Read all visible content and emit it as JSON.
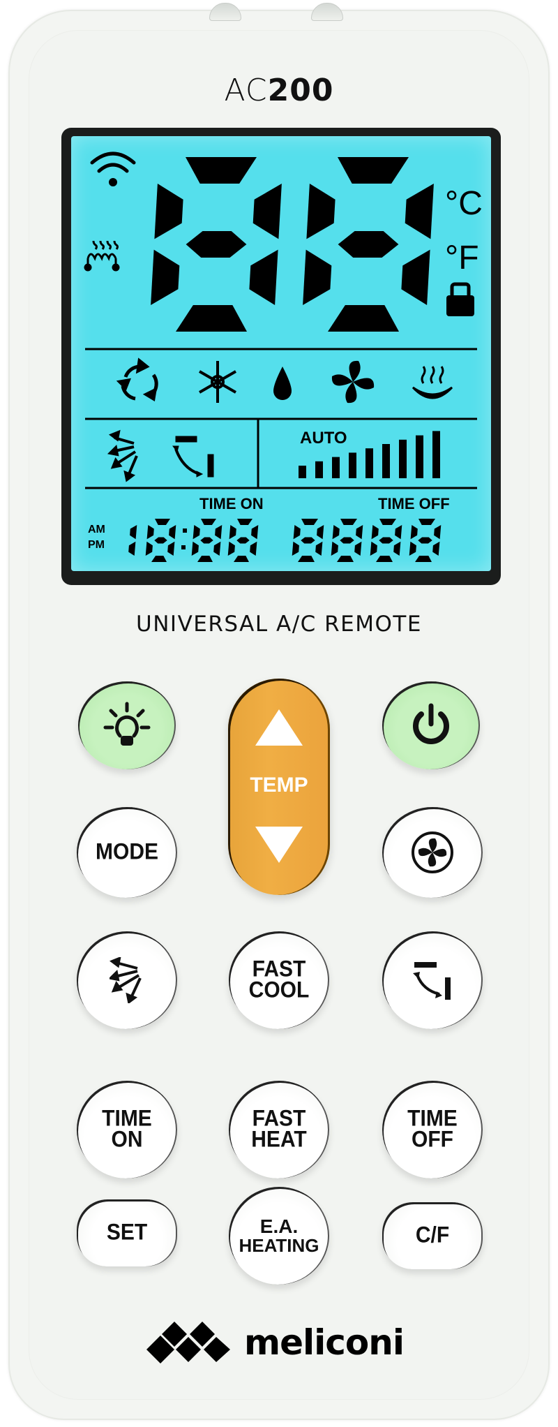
{
  "device": {
    "model_prefix": "AC",
    "model_number": "200",
    "subtitle": "UNIVERSAL A/C REMOTE",
    "brand": "meliconi",
    "colors": {
      "body": "#f3f5f2",
      "lcd_backlight": "#55dfec",
      "lcd_frame": "#1b1d1c",
      "green_button": "#c7f2bf",
      "temp_button": "#f0ae44"
    }
  },
  "lcd": {
    "main_temperature": "88",
    "unit_celsius": "°C",
    "unit_fahrenheit": "°F",
    "indicators_left": [
      "signal-icon",
      "heater-element-icon"
    ],
    "lock_icon": "lock-icon",
    "modes": [
      "auto-recycle-icon",
      "cool-snowflake-icon",
      "dry-drop-icon",
      "fan-icon",
      "heat-icon"
    ],
    "swing_icons": [
      "swing-icon",
      "flap-direction-icon"
    ],
    "fan_speed_label": "AUTO",
    "fan_speed_levels": 9,
    "time_on_label": "TIME ON",
    "time_off_label": "TIME OFF",
    "am_label": "AM",
    "pm_label": "PM",
    "time_on_value": "18:88",
    "time_off_value": "8888"
  },
  "buttons": {
    "light": {
      "icon": "light-bulb-icon"
    },
    "power": {
      "icon": "power-icon"
    },
    "temp": {
      "label": "TEMP",
      "up": "temp-up",
      "down": "temp-down"
    },
    "mode": {
      "label": "MODE"
    },
    "fan": {
      "icon": "fan-icon"
    },
    "swing": {
      "icon": "swing-icon"
    },
    "fast_cool": {
      "line1": "FAST",
      "line2": "COOL"
    },
    "flap": {
      "icon": "flap-direction-icon"
    },
    "time_on": {
      "line1": "TIME",
      "line2": "ON"
    },
    "fast_heat": {
      "line1": "FAST",
      "line2": "HEAT"
    },
    "time_off": {
      "line1": "TIME",
      "line2": "OFF"
    },
    "set": {
      "label": "SET"
    },
    "ea_heating": {
      "line1": "E.A.",
      "line2": "HEATING"
    },
    "cf": {
      "label": "C/F"
    }
  }
}
